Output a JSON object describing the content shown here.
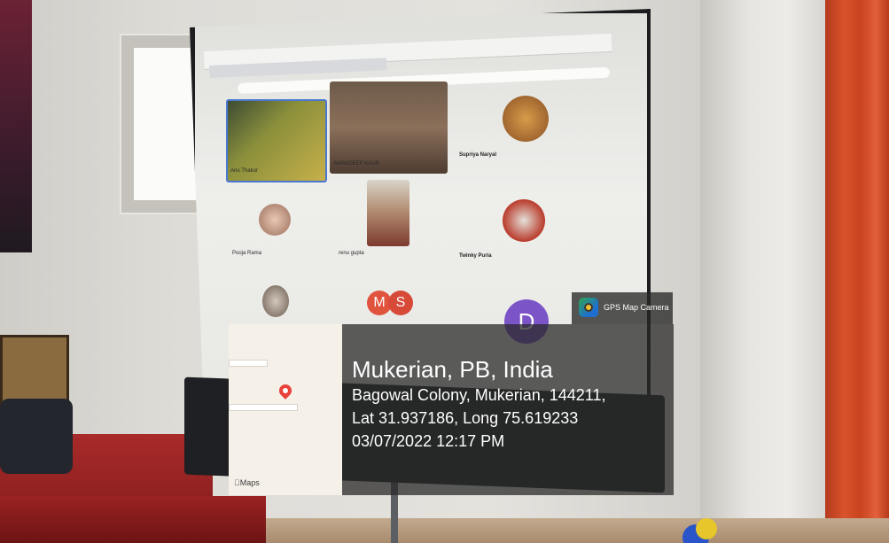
{
  "meeting": {
    "participants": [
      {
        "name": "Anu Thakur"
      },
      {
        "name": "AMANDEEP KAUR"
      },
      {
        "name": "Supriya Naryal"
      },
      {
        "name": "Pooja Rama"
      },
      {
        "name": "renu gupta"
      },
      {
        "name": "Twinky Puria"
      }
    ],
    "avatar_initials": [
      "M",
      "S",
      "D"
    ]
  },
  "gps_overlay": {
    "app_name": "GPS Map Camera",
    "map_attribution": "Maps",
    "title": "Mukerian, PB, India",
    "address": "Bagowal Colony, Mukerian, 144211,",
    "coordinates": "Lat 31.937186, Long 75.619233",
    "datetime": "03/07/2022 12:17 PM"
  },
  "colors": {
    "overlay_bg": "#2a2a2a",
    "pin": "#e8423a",
    "curtain": "#d9522c",
    "stage": "#a92a2a"
  }
}
